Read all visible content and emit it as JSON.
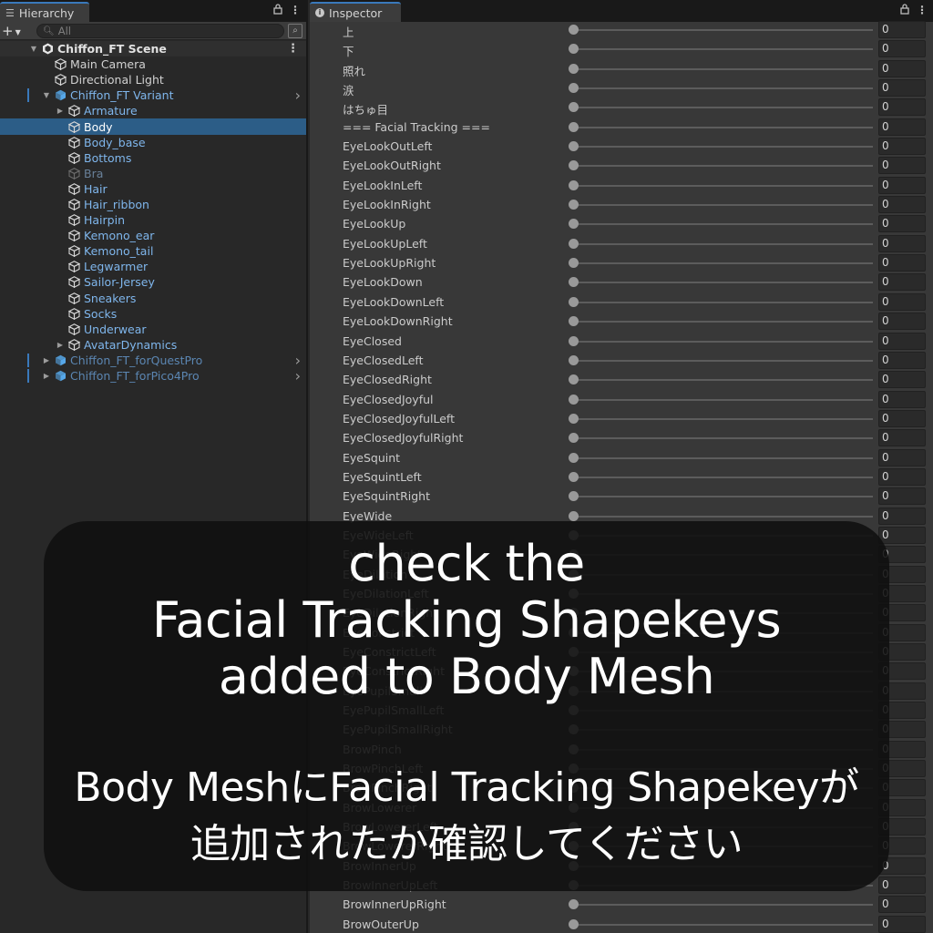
{
  "hierarchy": {
    "tab_label": "Hierarchy",
    "search_placeholder": "All",
    "scene_name": "Chiffon_FT Scene",
    "items": [
      {
        "label": "Main Camera",
        "depth": 2,
        "kind": "object",
        "state": "default"
      },
      {
        "label": "Directional Light",
        "depth": 2,
        "kind": "object",
        "state": "default"
      },
      {
        "label": "Chiffon_FT Variant",
        "depth": 2,
        "kind": "prefab",
        "state": "prefab",
        "expanded": true,
        "has_children": true,
        "arrow": true
      },
      {
        "label": "Armature",
        "depth": 3,
        "kind": "object",
        "state": "prefab",
        "has_children": true,
        "expanded": false
      },
      {
        "label": "Body",
        "depth": 3,
        "kind": "object",
        "state": "prefab",
        "selected": true
      },
      {
        "label": "Body_base",
        "depth": 3,
        "kind": "object",
        "state": "prefab"
      },
      {
        "label": "Bottoms",
        "depth": 3,
        "kind": "object",
        "state": "prefab"
      },
      {
        "label": "Bra",
        "depth": 3,
        "kind": "object",
        "state": "inactive"
      },
      {
        "label": "Hair",
        "depth": 3,
        "kind": "object",
        "state": "prefab"
      },
      {
        "label": "Hair_ribbon",
        "depth": 3,
        "kind": "object",
        "state": "prefab"
      },
      {
        "label": "Hairpin",
        "depth": 3,
        "kind": "object",
        "state": "prefab"
      },
      {
        "label": "Kemono_ear",
        "depth": 3,
        "kind": "object",
        "state": "prefab"
      },
      {
        "label": "Kemono_tail",
        "depth": 3,
        "kind": "object",
        "state": "prefab"
      },
      {
        "label": "Legwarmer",
        "depth": 3,
        "kind": "object",
        "state": "prefab"
      },
      {
        "label": "Sailor-Jersey",
        "depth": 3,
        "kind": "object",
        "state": "prefab"
      },
      {
        "label": "Sneakers",
        "depth": 3,
        "kind": "object",
        "state": "prefab"
      },
      {
        "label": "Socks",
        "depth": 3,
        "kind": "object",
        "state": "prefab"
      },
      {
        "label": "Underwear",
        "depth": 3,
        "kind": "object",
        "state": "prefab"
      },
      {
        "label": "AvatarDynamics",
        "depth": 3,
        "kind": "object",
        "state": "prefab",
        "has_children": true,
        "expanded": false
      },
      {
        "label": "Chiffon_FT_forQuestPro",
        "depth": 2,
        "kind": "prefab",
        "state": "prefab-dim",
        "has_children": true,
        "expanded": false,
        "arrow": true
      },
      {
        "label": "Chiffon_FT_forPico4Pro",
        "depth": 2,
        "kind": "prefab",
        "state": "prefab-dim",
        "has_children": true,
        "expanded": false,
        "arrow": true
      }
    ]
  },
  "inspector": {
    "tab_label": "Inspector",
    "shapekeys": [
      {
        "name": "上",
        "value": "0"
      },
      {
        "name": "下",
        "value": "0"
      },
      {
        "name": "照れ",
        "value": "0"
      },
      {
        "name": "涙",
        "value": "0"
      },
      {
        "name": "はちゅ目",
        "value": "0"
      },
      {
        "name": "=== Facial Tracking ===",
        "value": "0"
      },
      {
        "name": "EyeLookOutLeft",
        "value": "0"
      },
      {
        "name": "EyeLookOutRight",
        "value": "0"
      },
      {
        "name": "EyeLookInLeft",
        "value": "0"
      },
      {
        "name": "EyeLookInRight",
        "value": "0"
      },
      {
        "name": "EyeLookUp",
        "value": "0"
      },
      {
        "name": "EyeLookUpLeft",
        "value": "0"
      },
      {
        "name": "EyeLookUpRight",
        "value": "0"
      },
      {
        "name": "EyeLookDown",
        "value": "0"
      },
      {
        "name": "EyeLookDownLeft",
        "value": "0"
      },
      {
        "name": "EyeLookDownRight",
        "value": "0"
      },
      {
        "name": "EyeClosed",
        "value": "0"
      },
      {
        "name": "EyeClosedLeft",
        "value": "0"
      },
      {
        "name": "EyeClosedRight",
        "value": "0"
      },
      {
        "name": "EyeClosedJoyful",
        "value": "0"
      },
      {
        "name": "EyeClosedJoyfulLeft",
        "value": "0"
      },
      {
        "name": "EyeClosedJoyfulRight",
        "value": "0"
      },
      {
        "name": "EyeSquint",
        "value": "0"
      },
      {
        "name": "EyeSquintLeft",
        "value": "0"
      },
      {
        "name": "EyeSquintRight",
        "value": "0"
      },
      {
        "name": "EyeWide",
        "value": "0"
      },
      {
        "name": "EyeWideLeft",
        "value": "0"
      },
      {
        "name": "EyeWideRight",
        "value": "0"
      },
      {
        "name": "EyeDilation",
        "value": "0"
      },
      {
        "name": "EyeDilationLeft",
        "value": "0"
      },
      {
        "name": "EyeDilationRight",
        "value": "0"
      },
      {
        "name": "EyeConstrict",
        "value": "0"
      },
      {
        "name": "EyeConstrictLeft",
        "value": "0"
      },
      {
        "name": "EyeConstrictRight",
        "value": "0"
      },
      {
        "name": "EyePupilSmall",
        "value": "0"
      },
      {
        "name": "EyePupilSmallLeft",
        "value": "0"
      },
      {
        "name": "EyePupilSmallRight",
        "value": "0"
      },
      {
        "name": "BrowPinch",
        "value": "0"
      },
      {
        "name": "BrowPinchLeft",
        "value": "0"
      },
      {
        "name": "BrowPinchRight",
        "value": "0"
      },
      {
        "name": "BrowLowerer",
        "value": "0"
      },
      {
        "name": "BrowLowererLeft",
        "value": "0"
      },
      {
        "name": "BrowLowererRight",
        "value": "0"
      },
      {
        "name": "BrowInnerUp",
        "value": "0"
      },
      {
        "name": "BrowInnerUpLeft",
        "value": "0"
      },
      {
        "name": "BrowInnerUpRight",
        "value": "0"
      },
      {
        "name": "BrowOuterUp",
        "value": "0"
      }
    ]
  },
  "overlay": {
    "english_lines": [
      "check the",
      "Facial Tracking Shapekeys",
      "added to Body Mesh"
    ],
    "japanese_lines": [
      "Body MeshにFacial Tracking Shapekeyが",
      "追加されたか確認してください"
    ]
  },
  "colors": {
    "selection": "#2c5d87",
    "accent": "#3a79bb",
    "prefab_text": "#7fb6ec",
    "inactive_text": "#69819a"
  }
}
